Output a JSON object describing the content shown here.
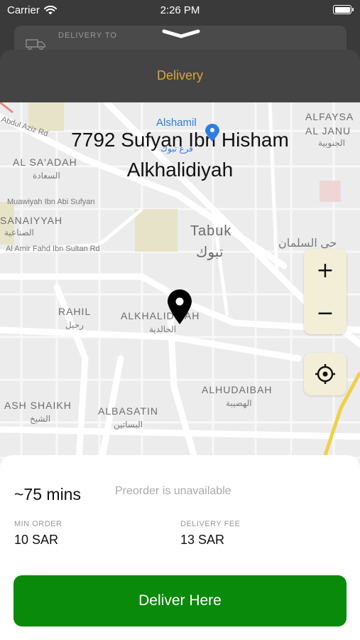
{
  "status_bar": {
    "carrier": "Carrier",
    "time": "2:26 PM"
  },
  "background_card": {
    "label": "DELIVERY TO"
  },
  "sheet": {
    "title": "Delivery"
  },
  "map": {
    "address_line1": "7792 Sufyan Ibn Hisham",
    "address_line2": "Alkhalidiyah",
    "poi": {
      "name": "Alshamil",
      "name_ar": "فرع تبوك"
    },
    "labels": {
      "abdul_aziz": "Abdul Aziz Rd",
      "alfaysaliyah": "ALFAYSA",
      "al_janubiyah": "AL JANU",
      "al_janubiyah_ar": "الجنوبية",
      "al_saadah": "AL SA'ADAH",
      "al_saadah_ar": "السعادة",
      "muawiyah": "Muawiyah Ibn Abi Sufyan",
      "sanaiyyah": "SANAIYYAH",
      "sanaiyyah_ar": "الصناعية",
      "amir_fahd": "Al Amir Fahd Ibn Sultan Rd",
      "tabuk": "Tabuk",
      "tabuk_ar": "تبوك",
      "salman_ar": "حي السلمان",
      "rahil": "RAHIL",
      "rahil_ar": "رحيل",
      "alkhalidiyah": "ALKHALIDIYAH",
      "alkhalidiyah_ar": "الخالدية",
      "alhudaibah": "ALHUDAIBAH",
      "alhudaibah_ar": "الهضيبة",
      "ash_shaikh": "ASH SHAIKH",
      "ash_shaikh_ar": "الشيخ",
      "albasatin": "ALBASATIN",
      "albasatin_ar": "البساتين"
    },
    "zoom_in_label": "+",
    "zoom_out_label": "−"
  },
  "panel": {
    "eta": "~75 mins",
    "preorder": "Preorder is unavailable",
    "min_order_label": "MIN ORDER",
    "min_order_value": "10 SAR",
    "delivery_fee_label": "DELIVERY FEE",
    "delivery_fee_value": "13 SAR",
    "button_label": "Deliver Here"
  },
  "colors": {
    "accent": "#d9a637",
    "primary_button": "#0a8a0a",
    "map_control_bg": "#f3eed7",
    "poi_blue": "#2f7de0"
  },
  "icons": [
    "wifi-icon",
    "battery-icon",
    "truck-icon",
    "chevron-down-icon",
    "map-pin-icon",
    "zoom-in-icon",
    "zoom-out-icon",
    "locate-icon",
    "poi-icon"
  ]
}
